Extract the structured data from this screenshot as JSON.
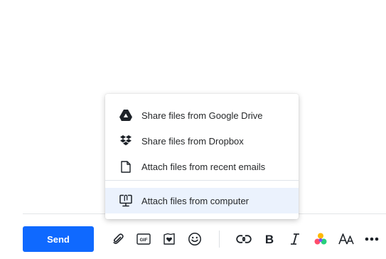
{
  "attach_menu": {
    "items": [
      {
        "label": "Share files from Google Drive",
        "icon": "google-drive-icon"
      },
      {
        "label": "Share files from Dropbox",
        "icon": "dropbox-icon"
      },
      {
        "label": "Attach files from recent emails",
        "icon": "document-icon"
      },
      {
        "label": "Attach files from computer",
        "icon": "computer-attach-icon",
        "highlighted": true
      }
    ]
  },
  "toolbar": {
    "send_label": "Send",
    "icons": [
      "paperclip-icon",
      "gif-icon",
      "sticker-icon",
      "emoji-icon",
      "link-icon",
      "bold-icon",
      "italic-icon",
      "color-palette-icon",
      "font-size-icon",
      "more-options-icon"
    ]
  },
  "colors": {
    "send_button": "#0f69ff",
    "menu_highlight": "#ebf2fd",
    "icon_dark": "#1d2228"
  }
}
